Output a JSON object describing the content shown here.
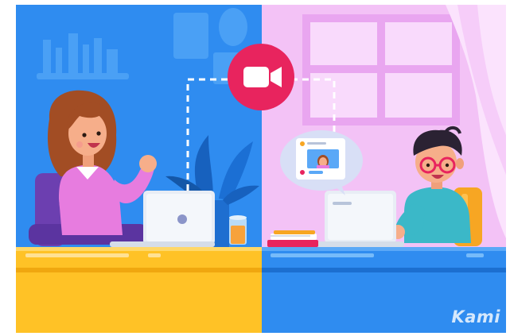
{
  "watermark": {
    "text": "Kami"
  },
  "icons": {
    "call_badge": "video-camera-icon",
    "chat_bubble": "video-call-preview-icon"
  },
  "colors": {
    "left_bg": "#2f8cf0",
    "right_bg": "#f3c2f6",
    "left_desk": "#ffc226",
    "right_desk": "#2f8cf0",
    "call_badge": "#e8245e"
  }
}
